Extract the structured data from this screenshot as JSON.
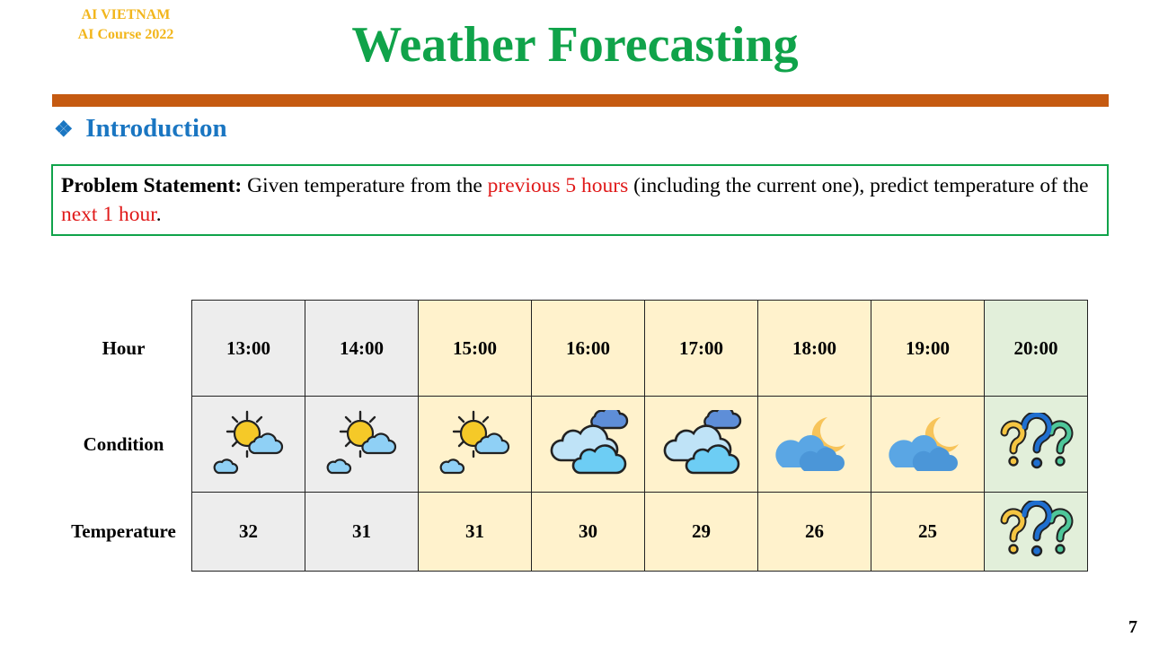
{
  "brand": {
    "line1": "AI VIETNAM",
    "line2": "AI Course 2022"
  },
  "title": "Weather Forecasting",
  "section": {
    "bullet": "❖",
    "heading": "Introduction"
  },
  "problem": {
    "label": "Problem Statement:",
    "text1": " Given temperature from the ",
    "highlight1": "previous 5 hours",
    "text2": " (including the current one), predict temperature of the ",
    "highlight2": "next 1 hour",
    "text3": "."
  },
  "table": {
    "row_labels": [
      "Hour",
      "Condition",
      "Temperature"
    ],
    "columns": [
      {
        "hour": "13:00",
        "condition": "sun-cloud-icon",
        "temperature": "32",
        "bg": "#ededed"
      },
      {
        "hour": "14:00",
        "condition": "sun-cloud-icon",
        "temperature": "31",
        "bg": "#ededed"
      },
      {
        "hour": "15:00",
        "condition": "sun-cloud-icon",
        "temperature": "31",
        "bg": "#fff2cc"
      },
      {
        "hour": "16:00",
        "condition": "cloudy-icon",
        "temperature": "30",
        "bg": "#fff2cc"
      },
      {
        "hour": "17:00",
        "condition": "cloudy-icon",
        "temperature": "29",
        "bg": "#fff2cc"
      },
      {
        "hour": "18:00",
        "condition": "moon-cloud-icon",
        "temperature": "26",
        "bg": "#fff2cc"
      },
      {
        "hour": "19:00",
        "condition": "moon-cloud-icon",
        "temperature": "25",
        "bg": "#fff2cc"
      },
      {
        "hour": "20:00",
        "condition": "question-marks-icon",
        "temperature": "question-marks-icon",
        "bg": "#e2efda"
      }
    ]
  },
  "page_number": "7",
  "colors": {
    "title": "#10a34a",
    "brand": "#f2b61c",
    "rule": "#c55a11",
    "section": "#1a76c2",
    "highlight": "#e01a1a"
  }
}
